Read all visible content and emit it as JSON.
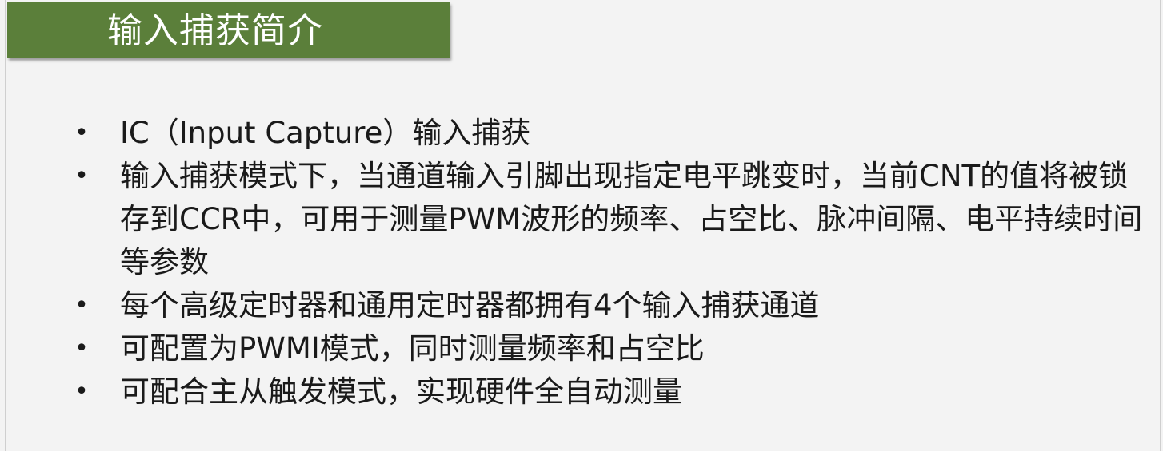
{
  "slide": {
    "title": "输入捕获简介",
    "bullets": [
      {
        "marker": "•",
        "text": "IC（Input Capture）输入捕获"
      },
      {
        "marker": "•",
        "text": "输入捕获模式下，当通道输入引脚出现指定电平跳变时，当前CNT的值将被锁存到CCR中，可用于测量PWM波形的频率、占空比、脉冲间隔、电平持续时间等参数"
      },
      {
        "marker": "•",
        "text": "每个高级定时器和通用定时器都拥有4个输入捕获通道"
      },
      {
        "marker": "•",
        "text": "可配置为PWMI模式，同时测量频率和占空比"
      },
      {
        "marker": "•",
        "text": "可配合主从触发模式，实现硬件全自动测量"
      }
    ]
  },
  "colors": {
    "title_bar": "#5b7f3a",
    "title_text": "#ffffff",
    "background": "#f3f3f3",
    "body_text": "#1a1a1a"
  }
}
